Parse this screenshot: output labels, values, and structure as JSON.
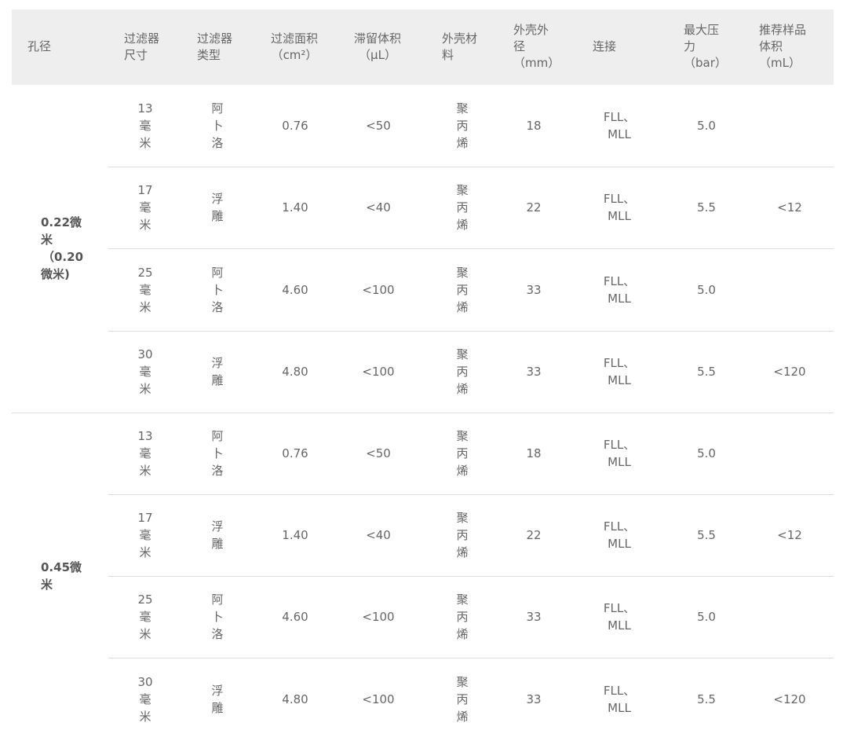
{
  "table": {
    "headers": {
      "pore": [
        "孔径"
      ],
      "size": [
        "过滤器",
        "尺寸"
      ],
      "type": [
        "过滤器",
        "类型"
      ],
      "area": [
        "过滤面积",
        "（cm²）"
      ],
      "holdup": [
        "滞留体积",
        "（µL）"
      ],
      "housing": [
        "外壳材",
        "料"
      ],
      "od": [
        "外壳外",
        "径",
        "（mm）"
      ],
      "conn": [
        "连接"
      ],
      "pressure": [
        "最大压",
        "力",
        "（bar）"
      ],
      "volume": [
        "推荐样品",
        "体积",
        "（mL）"
      ]
    },
    "groups": [
      {
        "pore": [
          "0.22微",
          "米",
          "（0.20",
          "微米)"
        ],
        "rows": [
          {
            "size": [
              "13",
              "毫",
              "米"
            ],
            "type": [
              "阿",
              "卜",
              "洛"
            ],
            "area": "0.76",
            "holdup": "<50",
            "housing": [
              "聚",
              "丙",
              "烯"
            ],
            "od": "18",
            "conn": [
              "FLL、",
              "MLL"
            ],
            "pressure": "5.0",
            "volume": ""
          },
          {
            "size": [
              "17",
              "毫",
              "米"
            ],
            "type": [
              "浮",
              "雕"
            ],
            "area": "1.40",
            "holdup": "<40",
            "housing": [
              "聚",
              "丙",
              "烯"
            ],
            "od": "22",
            "conn": [
              "FLL、",
              "MLL"
            ],
            "pressure": "5.5",
            "volume": "<12"
          },
          {
            "size": [
              "25",
              "毫",
              "米"
            ],
            "type": [
              "阿",
              "卜",
              "洛"
            ],
            "area": "4.60",
            "holdup": "<100",
            "housing": [
              "聚",
              "丙",
              "烯"
            ],
            "od": "33",
            "conn": [
              "FLL、",
              "MLL"
            ],
            "pressure": "5.0",
            "volume": ""
          },
          {
            "size": [
              "30",
              "毫",
              "米"
            ],
            "type": [
              "浮",
              "雕"
            ],
            "area": "4.80",
            "holdup": "<100",
            "housing": [
              "聚",
              "丙",
              "烯"
            ],
            "od": "33",
            "conn": [
              "FLL、",
              "MLL"
            ],
            "pressure": "5.5",
            "volume": "<120"
          }
        ]
      },
      {
        "pore": [
          "0.45微",
          "米"
        ],
        "rows": [
          {
            "size": [
              "13",
              "毫",
              "米"
            ],
            "type": [
              "阿",
              "卜",
              "洛"
            ],
            "area": "0.76",
            "holdup": "<50",
            "housing": [
              "聚",
              "丙",
              "烯"
            ],
            "od": "18",
            "conn": [
              "FLL、",
              "MLL"
            ],
            "pressure": "5.0",
            "volume": ""
          },
          {
            "size": [
              "17",
              "毫",
              "米"
            ],
            "type": [
              "浮",
              "雕"
            ],
            "area": "1.40",
            "holdup": "<40",
            "housing": [
              "聚",
              "丙",
              "烯"
            ],
            "od": "22",
            "conn": [
              "FLL、",
              "MLL"
            ],
            "pressure": "5.5",
            "volume": "<12"
          },
          {
            "size": [
              "25",
              "毫",
              "米"
            ],
            "type": [
              "阿",
              "卜",
              "洛"
            ],
            "area": "4.60",
            "holdup": "<100",
            "housing": [
              "聚",
              "丙",
              "烯"
            ],
            "od": "33",
            "conn": [
              "FLL、",
              "MLL"
            ],
            "pressure": "5.0",
            "volume": ""
          },
          {
            "size": [
              "30",
              "毫",
              "米"
            ],
            "type": [
              "浮",
              "雕"
            ],
            "area": "4.80",
            "holdup": "<100",
            "housing": [
              "聚",
              "丙",
              "烯"
            ],
            "od": "33",
            "conn": [
              "FLL、",
              "MLL"
            ],
            "pressure": "5.5",
            "volume": "<120"
          }
        ]
      }
    ]
  }
}
